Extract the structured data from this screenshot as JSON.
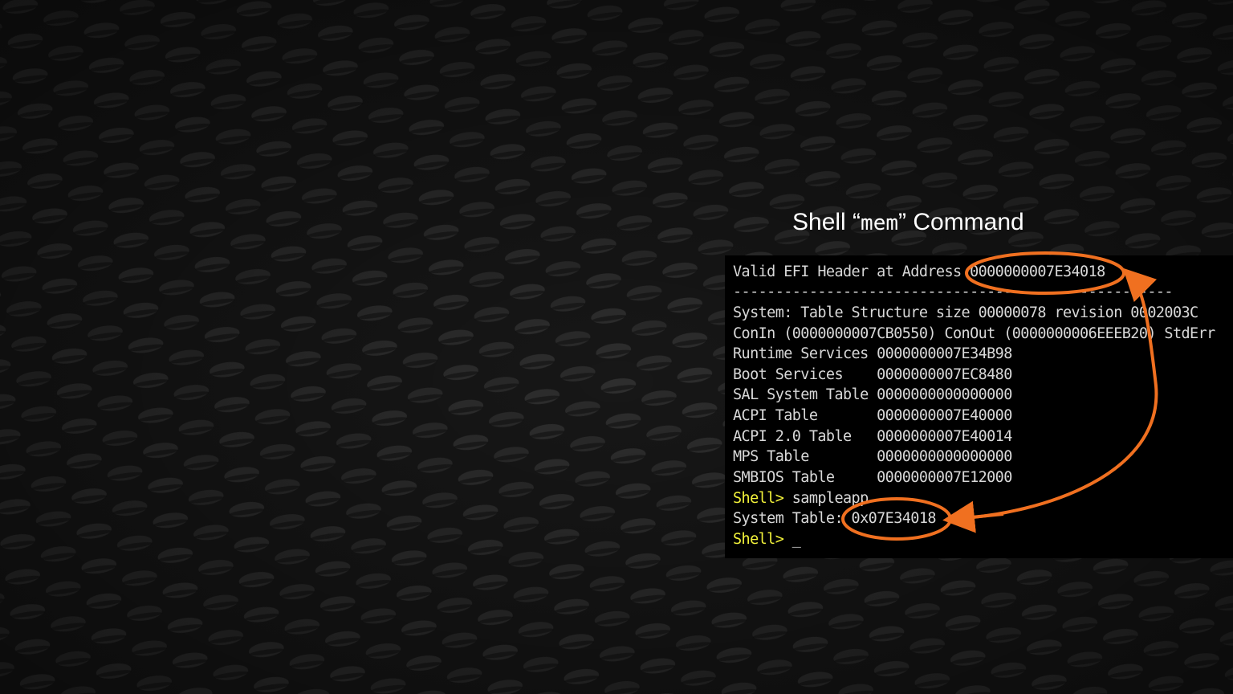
{
  "slide": {
    "title_pre": "Shell  “",
    "title_cmd": "mem",
    "title_post": "” Command"
  },
  "terminal": {
    "lines": [
      "Valid EFI Header at Address 0000000007E34018",
      "----------------------------------------------------",
      "System: Table Structure size 00000078 revision 0002003C",
      "ConIn (0000000007CB0550) ConOut (0000000006EEEB20) StdErr",
      "Runtime Services 0000000007E34B98",
      "Boot Services    0000000007EC8480",
      "SAL System Table 0000000000000000",
      "ACPI Table       0000000007E40000",
      "ACPI 2.0 Table   0000000007E40014",
      "MPS Table        0000000000000000",
      "SMBIOS Table     0000000007E12000"
    ],
    "prompt": "Shell>",
    "command": " sampleapp",
    "result_line": "System Table: 0x07E34018",
    "cursor": " _"
  },
  "colors": {
    "background": "#1c1c1c",
    "terminal_bg": "#000000",
    "terminal_text": "#d8d8d8",
    "prompt": "#f2f23a",
    "annotation": "#f07020",
    "title": "#ffffff"
  }
}
